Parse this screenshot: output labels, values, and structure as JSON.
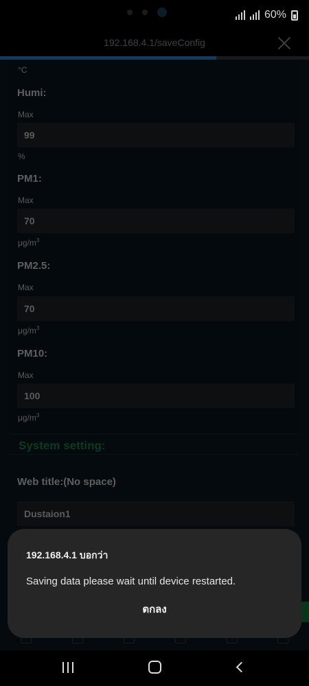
{
  "status_bar": {
    "battery_text": "60%"
  },
  "browser": {
    "url": "192.168.4.1/saveConfig",
    "load_progress": 0.7
  },
  "form": {
    "temp_unit": "°C",
    "humi": {
      "heading": "Humi:",
      "max_label": "Max",
      "max_value": "99",
      "unit": "%"
    },
    "pm1": {
      "heading": "PM1:",
      "max_label": "Max",
      "max_value": "70",
      "unit": "μg/m",
      "unit_sup": "3"
    },
    "pm25": {
      "heading": "PM2.5:",
      "max_label": "Max",
      "max_value": "70",
      "unit": "μg/m",
      "unit_sup": "3"
    },
    "pm10": {
      "heading": "PM10:",
      "max_label": "Max",
      "max_value": "100",
      "unit": "μg/m",
      "unit_sup": "3"
    },
    "system_setting_title": "System setting:",
    "web_title_label": "Web title:(No space)",
    "web_title_value": "Dustaion1"
  },
  "dialog": {
    "title": "192.168.4.1 บอกว่า",
    "message": "Saving data please wait until device restarted.",
    "ok_label": "ตกลง"
  }
}
